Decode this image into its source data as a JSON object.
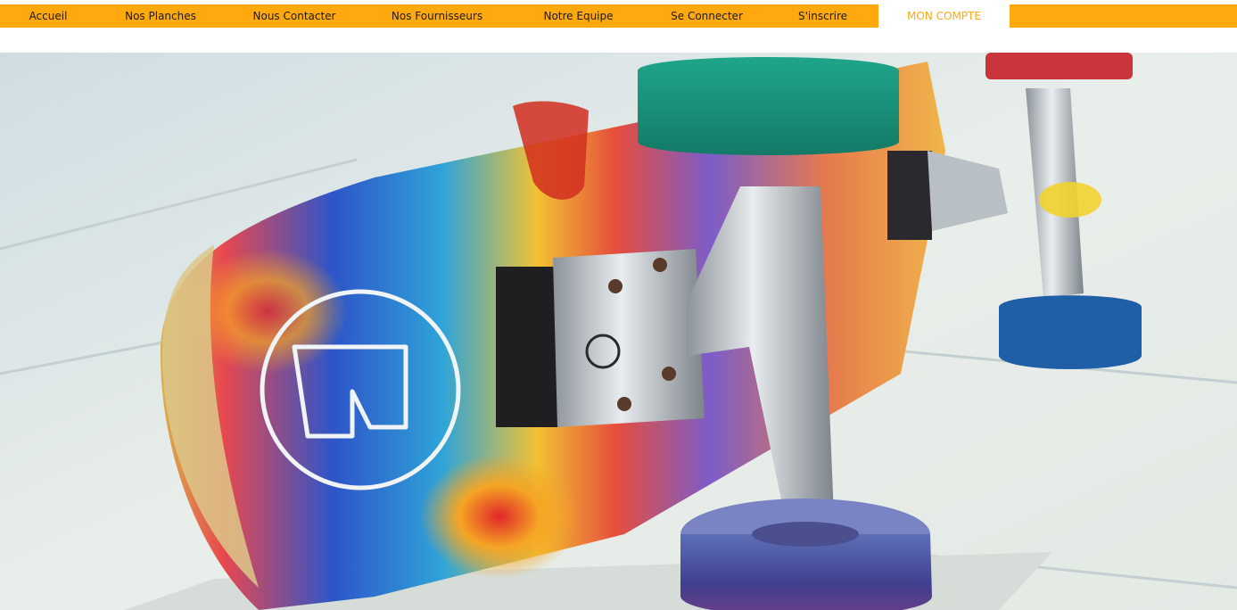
{
  "nav": {
    "items": [
      {
        "label": "Accueil"
      },
      {
        "label": "Nos Planches"
      },
      {
        "label": "Nous Contacter"
      },
      {
        "label": "Nos Fournisseurs"
      },
      {
        "label": "Notre Equipe"
      },
      {
        "label": "Se Connecter"
      },
      {
        "label": "S'inscrire"
      },
      {
        "label": "MON COMPTE",
        "active": true
      }
    ]
  },
  "colors": {
    "nav_background": "#ffa90f",
    "nav_active_background": "#ffffff",
    "nav_active_text": "#ffa90f",
    "nav_text": "#1a1a1a"
  },
  "hero": {
    "subject": "tie-dye skateboard close-up photo"
  }
}
